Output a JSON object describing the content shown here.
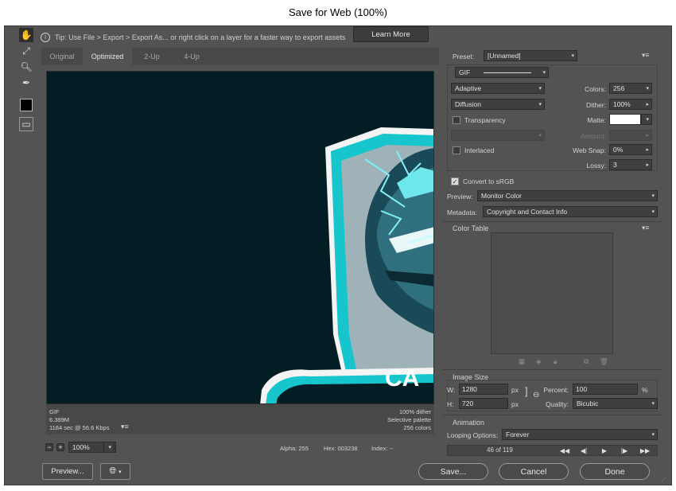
{
  "window": {
    "title": "Save for Web (100%)"
  },
  "tip": {
    "text": "Tip: Use File > Export > Export As...  or right click on a layer for a faster way to export assets",
    "learn_more": "Learn More"
  },
  "tabs": [
    {
      "label": "Original"
    },
    {
      "label": "Optimized"
    },
    {
      "label": "2-Up"
    },
    {
      "label": "4-Up"
    }
  ],
  "canvas": {
    "text": "CA"
  },
  "info_left": {
    "format": "GIF",
    "size": "6.389M",
    "time": "1184 sec @ 56.6 Kbps"
  },
  "info_right": {
    "dither": "100% dither",
    "palette": "Selective palette",
    "colors": "256 colors"
  },
  "status": {
    "zoom": "100%",
    "alpha": "Alpha: 255",
    "hex": "Hex: 003238",
    "index": "Index: --"
  },
  "bottom": {
    "preview": "Preview...",
    "save": "Save...",
    "cancel": "Cancel",
    "done": "Done"
  },
  "settings": {
    "preset_label": "Preset:",
    "preset_value": "[Unnamed]",
    "format": "GIF",
    "reduction": "Adaptive",
    "dither_algo": "Diffusion",
    "colors_label": "Colors:",
    "colors_value": "256",
    "dither_label": "Dither:",
    "dither_value": "100%",
    "transparency_label": "Transparency",
    "matte_label": "Matte:",
    "amount_label": "Amount:",
    "interlaced_label": "Interlaced",
    "websnap_label": "Web Snap:",
    "websnap_value": "0%",
    "lossy_label": "Lossy:",
    "lossy_value": "3",
    "convert_label": "Convert to sRGB",
    "preview_label": "Preview:",
    "preview_value": "Monitor Color",
    "metadata_label": "Metadata:",
    "metadata_value": "Copyright and Contact Info"
  },
  "color_table": {
    "title": "Color Table"
  },
  "image_size": {
    "title": "Image Size",
    "w_label": "W:",
    "w_value": "1280",
    "h_label": "H:",
    "h_value": "720",
    "unit": "px",
    "percent_label": "Percent:",
    "percent_value": "100",
    "percent_unit": "%",
    "quality_label": "Quality:",
    "quality_value": "Bicubic"
  },
  "animation": {
    "title": "Animation",
    "looping_label": "Looping Options:",
    "looping_value": "Forever",
    "frame_text": "46 of 119"
  },
  "colors": {
    "accent": "#16c6cc",
    "canvas_bg": "#021e24",
    "panel_bg": "#535353"
  }
}
